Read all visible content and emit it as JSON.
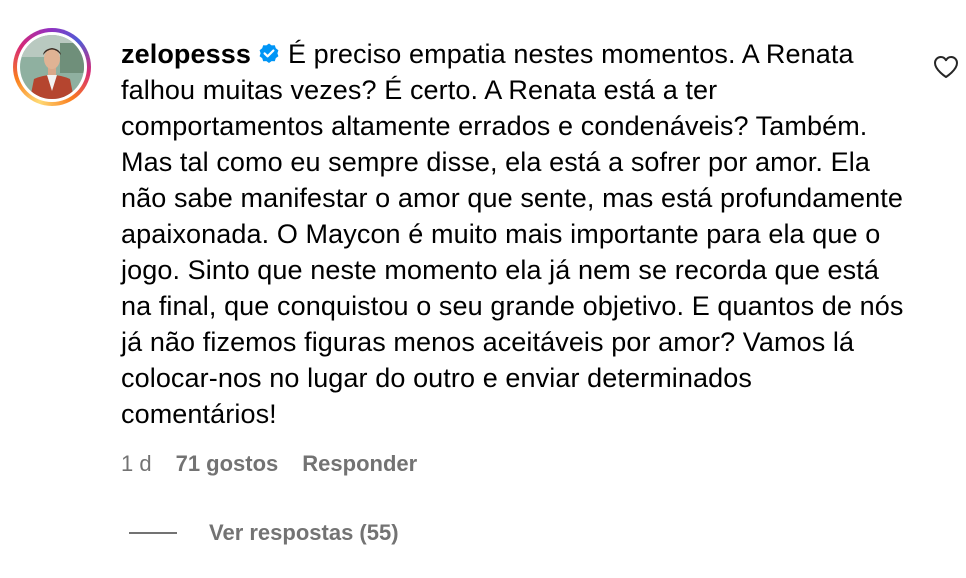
{
  "comment": {
    "username": "zelopesss",
    "verified": true,
    "text": "É preciso empatia nestes momentos. A Renata falhou muitas vezes? É certo. A Renata está a ter comportamentos altamente errados e condenáveis? Também. Mas tal como eu sempre disse, ela está a sofrer por amor. Ela não sabe manifestar o amor que sente, mas está profundamente apaixonada. O Maycon é muito mais importante para ela que o jogo. Sinto que neste momento ela já nem se recorda que está na final, que conquistou o seu grande objetivo. E quantos de nós já não fizemos figuras menos aceitáveis por amor? Vamos lá colocar-nos no lugar do outro e enviar determinados comentários!",
    "age": "1 d",
    "likes": "71 gostos",
    "reply_label": "Responder",
    "view_replies": "Ver respostas (55)"
  },
  "colors": {
    "verified_blue": "#0095f6",
    "meta_gray": "#737373",
    "text": "#000000"
  },
  "icons": {
    "avatar": "profile-photo",
    "verified": "verified-badge-icon",
    "like": "heart-outline-icon"
  }
}
